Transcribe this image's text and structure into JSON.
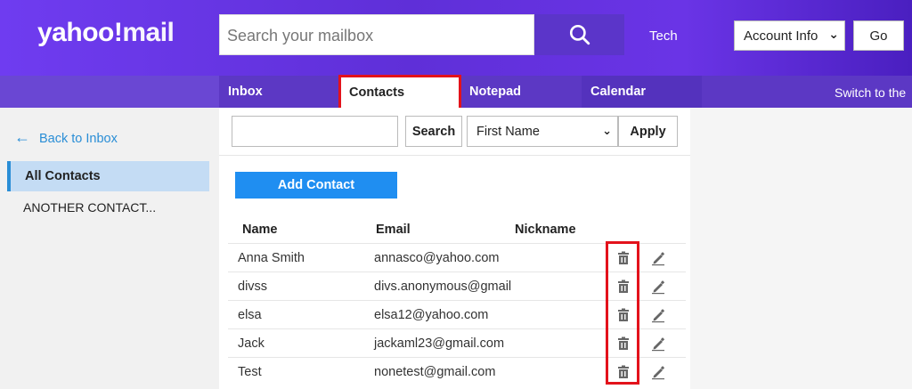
{
  "header": {
    "logo_main": "yahoo",
    "logo_bang": "!",
    "logo_mail": "mail",
    "search_placeholder": "Search your mailbox",
    "tech_label": "Tech",
    "account_select": "Account Info",
    "go_label": "Go"
  },
  "nav": {
    "tabs": [
      {
        "label": "Inbox"
      },
      {
        "label": "Contacts"
      },
      {
        "label": "Notepad"
      },
      {
        "label": "Calendar"
      }
    ],
    "switch_text": "Switch to the"
  },
  "sidebar": {
    "back_label": "Back to Inbox",
    "items": [
      {
        "label": "All Contacts"
      },
      {
        "label": "ANOTHER CONTACT..."
      }
    ]
  },
  "contacts": {
    "search_button": "Search",
    "sort_select": "First Name",
    "apply_button": "Apply",
    "add_button": "Add Contact",
    "columns": [
      "Name",
      "Email",
      "Nickname"
    ],
    "rows": [
      {
        "name": "Anna Smith",
        "email": "annasco@yahoo.com",
        "nickname": ""
      },
      {
        "name": "divss",
        "email": "divs.anonymous@gmail",
        "nickname": ""
      },
      {
        "name": "elsa",
        "email": "elsa12@yahoo.com",
        "nickname": ""
      },
      {
        "name": "Jack",
        "email": "jackaml23@gmail.com",
        "nickname": ""
      },
      {
        "name": "Test",
        "email": "nonetest@gmail.com",
        "nickname": ""
      }
    ]
  },
  "colors": {
    "header_purple": "#6f3cf0",
    "nav_purple": "#5c38c4",
    "accent_blue": "#1f8ef1",
    "highlight_red": "#e3121b"
  },
  "icons": {
    "search": "search-icon",
    "back": "arrow-left-icon",
    "trash": "trash-icon",
    "edit": "pencil-icon",
    "chevron": "chevron-down-icon"
  }
}
